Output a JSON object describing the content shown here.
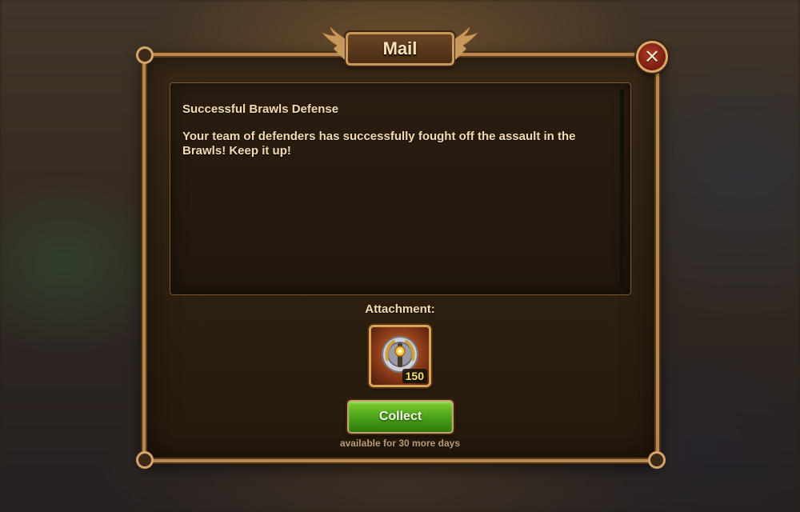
{
  "dialog": {
    "title": "Mail",
    "close_icon": "close-x-icon"
  },
  "message": {
    "subject": "Successful Brawls Defense",
    "body": "Your team of defenders has successfully fought off the assault in the Brawls! Keep it up!"
  },
  "attachment": {
    "label": "Attachment:",
    "item_icon": "brawl-medal-icon",
    "count": "150"
  },
  "actions": {
    "collect_label": "Collect",
    "expiry_text": "available for 30 more days"
  },
  "colors": {
    "frame": "#b9884f",
    "text": "#f4dcb2",
    "collect": "#4ba31a",
    "close": "#7a1c10"
  }
}
